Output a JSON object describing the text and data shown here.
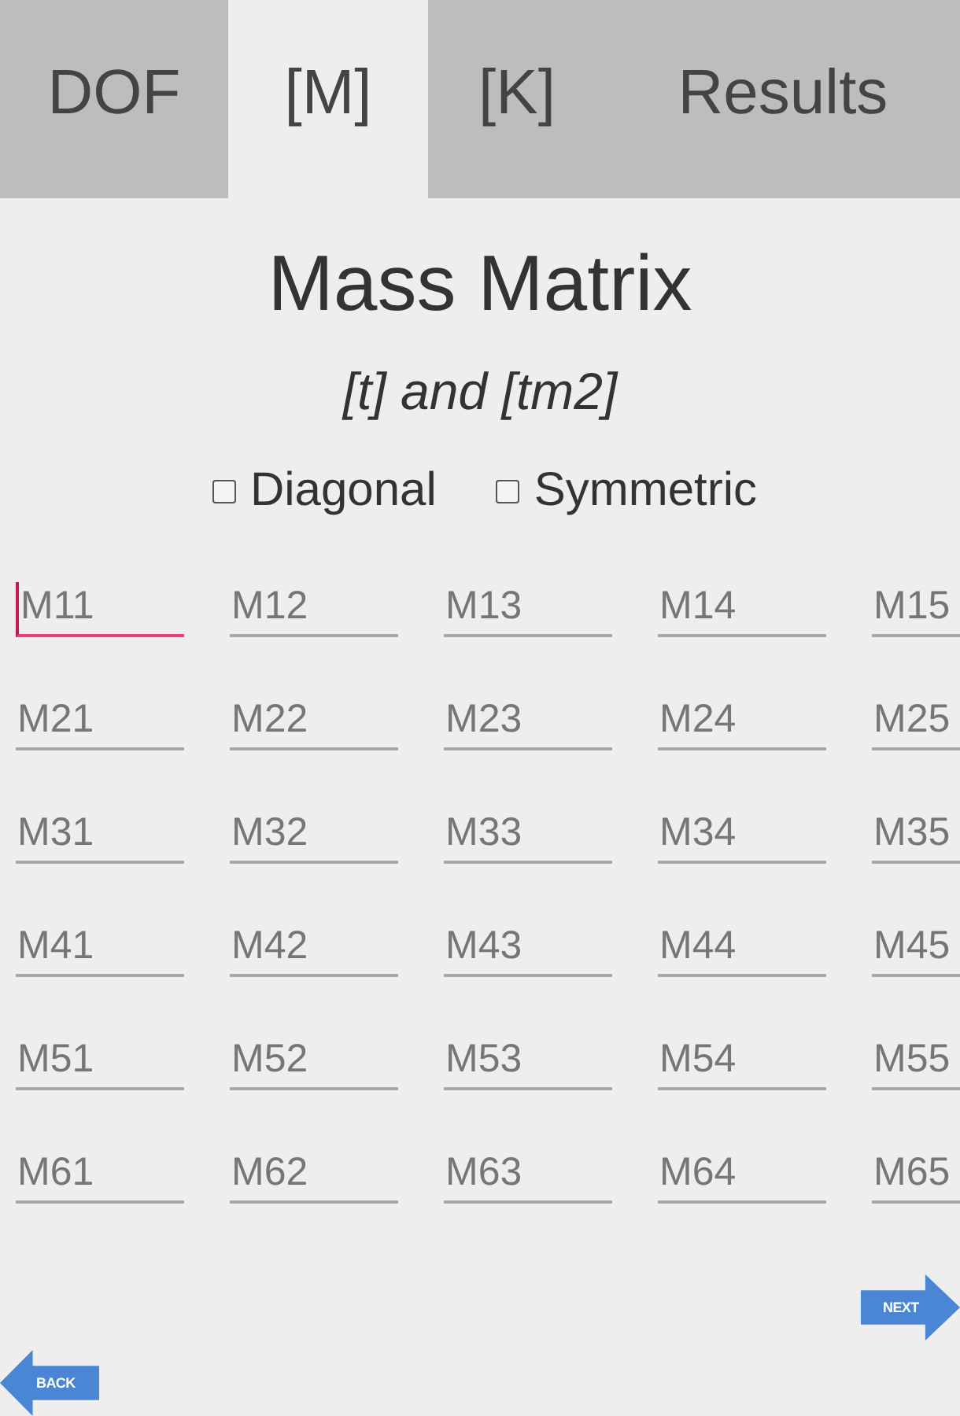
{
  "tabs": [
    {
      "label": "DOF",
      "selected": false
    },
    {
      "label": "[M]",
      "selected": true
    },
    {
      "label": "[K]",
      "selected": false
    },
    {
      "label": "Results",
      "selected": false
    }
  ],
  "title": "Mass Matrix",
  "subtitle": "[t] and [tm2]",
  "options": [
    {
      "label": "Diagonal",
      "checked": false
    },
    {
      "label": "Symmetric",
      "checked": false
    }
  ],
  "matrix": {
    "rows": [
      [
        {
          "placeholder": "M11",
          "focused": true
        },
        {
          "placeholder": "M12",
          "focused": false
        },
        {
          "placeholder": "M13",
          "focused": false
        },
        {
          "placeholder": "M14",
          "focused": false
        },
        {
          "placeholder": "M15",
          "focused": false
        }
      ],
      [
        {
          "placeholder": "M21",
          "focused": false
        },
        {
          "placeholder": "M22",
          "focused": false
        },
        {
          "placeholder": "M23",
          "focused": false
        },
        {
          "placeholder": "M24",
          "focused": false
        },
        {
          "placeholder": "M25",
          "focused": false
        }
      ],
      [
        {
          "placeholder": "M31",
          "focused": false
        },
        {
          "placeholder": "M32",
          "focused": false
        },
        {
          "placeholder": "M33",
          "focused": false
        },
        {
          "placeholder": "M34",
          "focused": false
        },
        {
          "placeholder": "M35",
          "focused": false
        }
      ],
      [
        {
          "placeholder": "M41",
          "focused": false
        },
        {
          "placeholder": "M42",
          "focused": false
        },
        {
          "placeholder": "M43",
          "focused": false
        },
        {
          "placeholder": "M44",
          "focused": false
        },
        {
          "placeholder": "M45",
          "focused": false
        }
      ],
      [
        {
          "placeholder": "M51",
          "focused": false
        },
        {
          "placeholder": "M52",
          "focused": false
        },
        {
          "placeholder": "M53",
          "focused": false
        },
        {
          "placeholder": "M54",
          "focused": false
        },
        {
          "placeholder": "M55",
          "focused": false
        }
      ],
      [
        {
          "placeholder": "M61",
          "focused": false
        },
        {
          "placeholder": "M62",
          "focused": false
        },
        {
          "placeholder": "M63",
          "focused": false
        },
        {
          "placeholder": "M64",
          "focused": false
        },
        {
          "placeholder": "M65",
          "focused": false
        }
      ]
    ]
  },
  "nav": [
    {
      "kind": "next",
      "label": "NEXT"
    },
    {
      "kind": "back",
      "label": "BACK"
    }
  ]
}
